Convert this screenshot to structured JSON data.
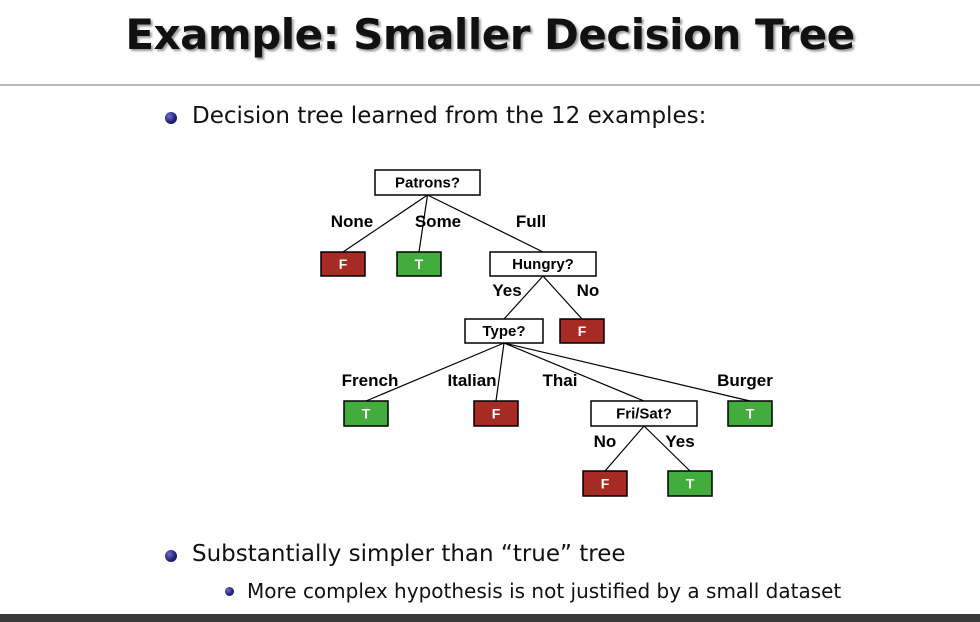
{
  "slide": {
    "title": "Example: Smaller Decision Tree",
    "bullets": [
      "Decision tree learned from the 12 examples:",
      "Substantially simpler than “true” tree"
    ],
    "sub_bullets": [
      "More complex hypothesis is not justified by a small dataset"
    ]
  },
  "colors": {
    "false_leaf": "#a62b24",
    "true_leaf": "#42ad3c"
  },
  "tree": {
    "nodes": [
      {
        "id": "patrons",
        "kind": "test",
        "label": "Patrons?"
      },
      {
        "id": "leaf-none",
        "kind": "false",
        "label": "F"
      },
      {
        "id": "leaf-some",
        "kind": "true",
        "label": "T"
      },
      {
        "id": "hungry",
        "kind": "test",
        "label": "Hungry?"
      },
      {
        "id": "leaf-hungry-no",
        "kind": "false",
        "label": "F"
      },
      {
        "id": "type",
        "kind": "test",
        "label": "Type?"
      },
      {
        "id": "leaf-french",
        "kind": "true",
        "label": "T"
      },
      {
        "id": "leaf-italian",
        "kind": "false",
        "label": "F"
      },
      {
        "id": "frisat",
        "kind": "test",
        "label": "Fri/Sat?"
      },
      {
        "id": "leaf-burger",
        "kind": "true",
        "label": "T"
      },
      {
        "id": "leaf-frisat-no",
        "kind": "false",
        "label": "F"
      },
      {
        "id": "leaf-frisat-yes",
        "kind": "true",
        "label": "T"
      }
    ],
    "edges": [
      {
        "from": "patrons",
        "to": "leaf-none",
        "label": "None"
      },
      {
        "from": "patrons",
        "to": "leaf-some",
        "label": "Some"
      },
      {
        "from": "patrons",
        "to": "hungry",
        "label": "Full"
      },
      {
        "from": "hungry",
        "to": "type",
        "label": "Yes"
      },
      {
        "from": "hungry",
        "to": "leaf-hungry-no",
        "label": "No"
      },
      {
        "from": "type",
        "to": "leaf-french",
        "label": "French"
      },
      {
        "from": "type",
        "to": "leaf-italian",
        "label": "Italian"
      },
      {
        "from": "type",
        "to": "frisat",
        "label": "Thai"
      },
      {
        "from": "type",
        "to": "leaf-burger",
        "label": "Burger"
      },
      {
        "from": "frisat",
        "to": "leaf-frisat-no",
        "label": "No"
      },
      {
        "from": "frisat",
        "to": "leaf-frisat-yes",
        "label": "Yes"
      }
    ]
  }
}
